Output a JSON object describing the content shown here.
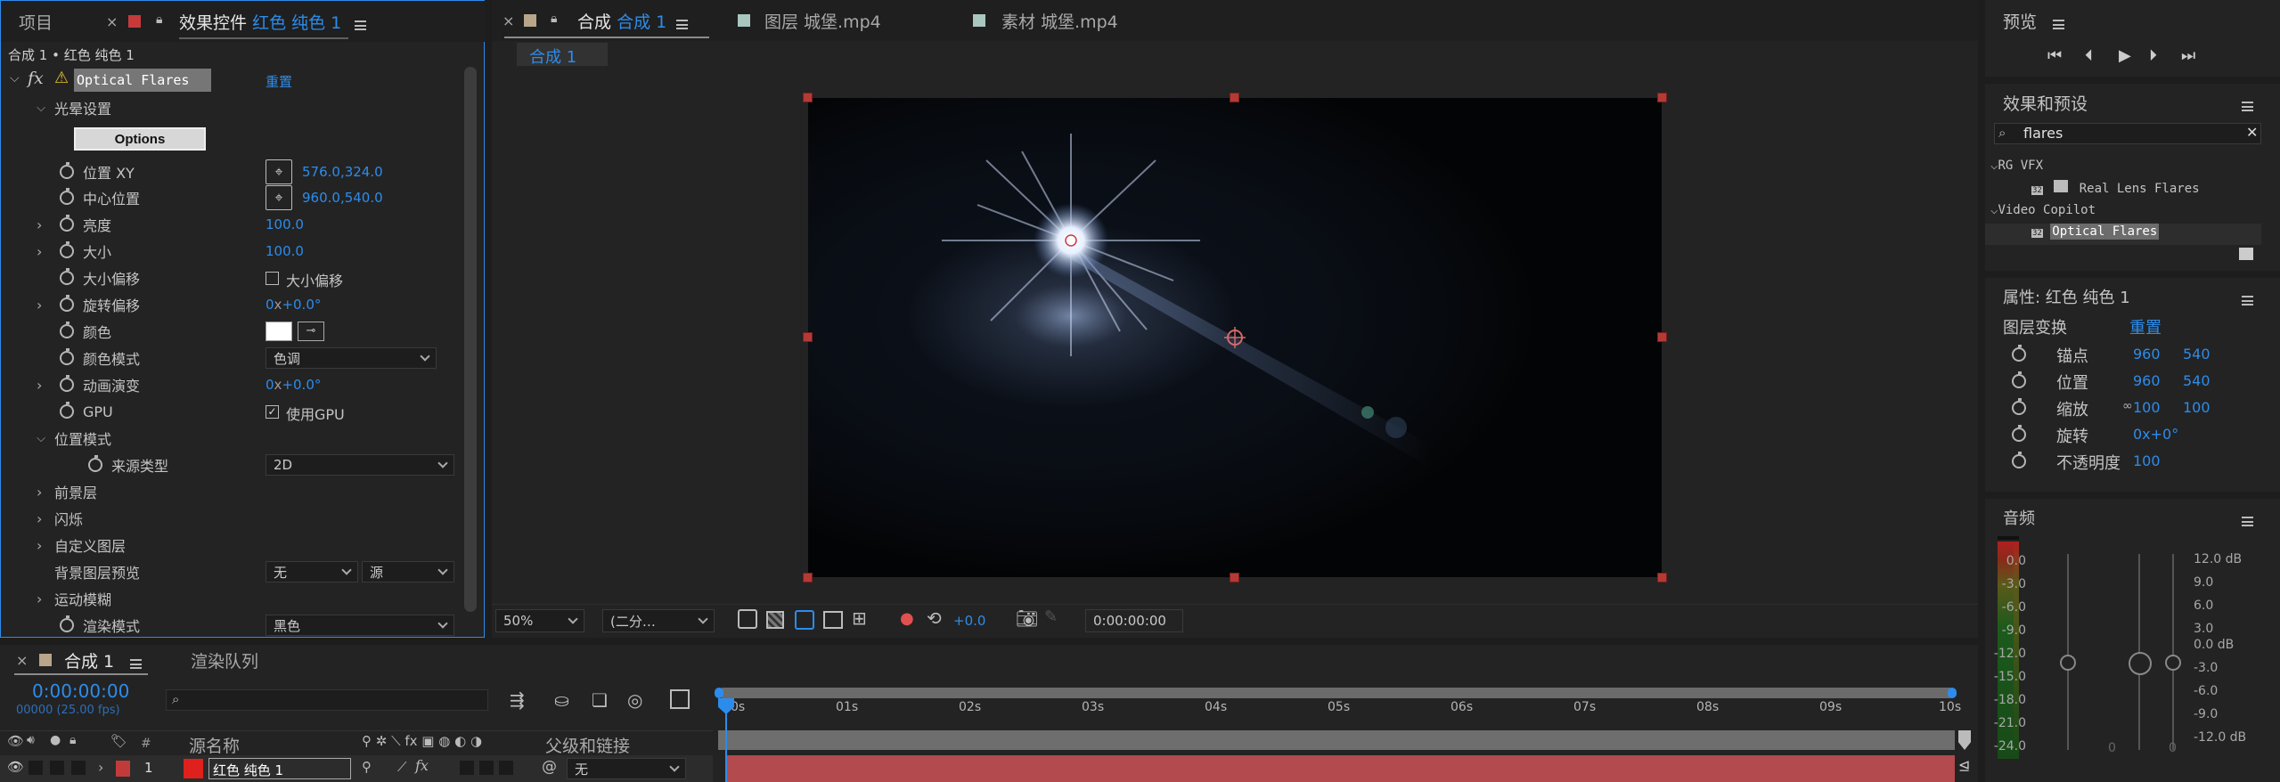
{
  "project_panel": {
    "tab_label": "项目"
  },
  "effect_controls": {
    "tab_prefix": "效果控件",
    "tab_layer": "红色 纯色 1",
    "breadcrumb": "合成 1 • 红色 纯色 1",
    "effect_name": "Optical Flares",
    "reset_label": "重置",
    "group_flare": "光晕设置",
    "options_button": "Options",
    "rows": [
      {
        "label": "位置 XY",
        "value": "576.0,324.0"
      },
      {
        "label": "中心位置",
        "value": "960.0,540.0"
      },
      {
        "label": "亮度",
        "value": "100.0"
      },
      {
        "label": "大小",
        "value": "100.0"
      },
      {
        "label": "大小偏移",
        "value": "大小偏移"
      },
      {
        "label": "旋转偏移",
        "value_prefix": "0",
        "value_x": "x",
        "value": "+0.0°"
      },
      {
        "label": "颜色"
      },
      {
        "label": "颜色模式",
        "value": "色调"
      },
      {
        "label": "动画演变",
        "value_prefix": "0",
        "value_x": "x",
        "value": "+0.0°"
      },
      {
        "label": "GPU",
        "value": "使用GPU"
      }
    ],
    "group_position": "位置模式",
    "source_type_label": "来源类型",
    "source_type_value": "2D",
    "foreground": "前景层",
    "flicker": "闪烁",
    "custom_layer": "自定义图层",
    "bg_preview_label": "背景图层预览",
    "bg_preview_value1": "无",
    "bg_preview_value2": "源",
    "motion_blur": "运动模糊",
    "render_mode_label": "渲染模式",
    "render_mode_value": "黑色"
  },
  "composition": {
    "tab_prefix": "合成",
    "tab_name": "合成 1",
    "layer_tab": "图层 城堡.mp4",
    "footage_tab": "素材 城堡.mp4",
    "sub_tab": "合成 1",
    "zoom": "50%",
    "resolution": "(二分…",
    "exposure": "+0.0",
    "timecode": "0:00:00:00"
  },
  "preview": {
    "title": "预览"
  },
  "effects_presets": {
    "title": "效果和预设",
    "search_value": "flares",
    "category1": "RG VFX",
    "item1": "Real Lens Flares",
    "category2": "Video Copilot",
    "item2": "Optical Flares",
    "bit_badge": "32"
  },
  "properties": {
    "title": "属性: 红色 纯色 1",
    "transform_label": "图层变换",
    "reset": "重置",
    "rows": [
      {
        "label": "锚点",
        "v1": "960",
        "v2": "540"
      },
      {
        "label": "位置",
        "v1": "960",
        "v2": "540"
      },
      {
        "label": "缩放",
        "v1": "100",
        "v2": "100"
      },
      {
        "label": "旋转",
        "v1": "0x+0°",
        "v2": ""
      },
      {
        "label": "不透明度",
        "v1": "100",
        "v2": ""
      }
    ]
  },
  "audio": {
    "title": "音频",
    "left_scale": [
      "0.0",
      "-3.0",
      "-6.0",
      "-9.0",
      "-12.0",
      "-15.0",
      "-18.0",
      "-21.0",
      "-24.0"
    ],
    "right_scale": [
      "12.0 dB",
      "9.0",
      "6.0",
      "3.0",
      "0.0 dB",
      "-3.0",
      "-6.0",
      "-9.0",
      "-12.0 dB"
    ],
    "fader_zero1": "0",
    "fader_zero2": "0"
  },
  "timeline": {
    "tab_name": "合成 1",
    "render_queue": "渲染队列",
    "timecode": "0:00:00:00",
    "fps": "00000 (25.00 fps)",
    "ruler": [
      "0s",
      "01s",
      "02s",
      "03s",
      "04s",
      "05s",
      "06s",
      "07s",
      "08s",
      "09s",
      "10s"
    ],
    "col_source_name": "源名称",
    "col_parent": "父级和链接",
    "col_num": "#",
    "layer_num": "1",
    "layer_name": "红色 纯色 1",
    "layer_parent": "无"
  },
  "colors": {
    "accent": "#2d8ceb",
    "layer_red": "#e0201c",
    "clip_red": "#b34a4d",
    "panel": "#232323"
  }
}
